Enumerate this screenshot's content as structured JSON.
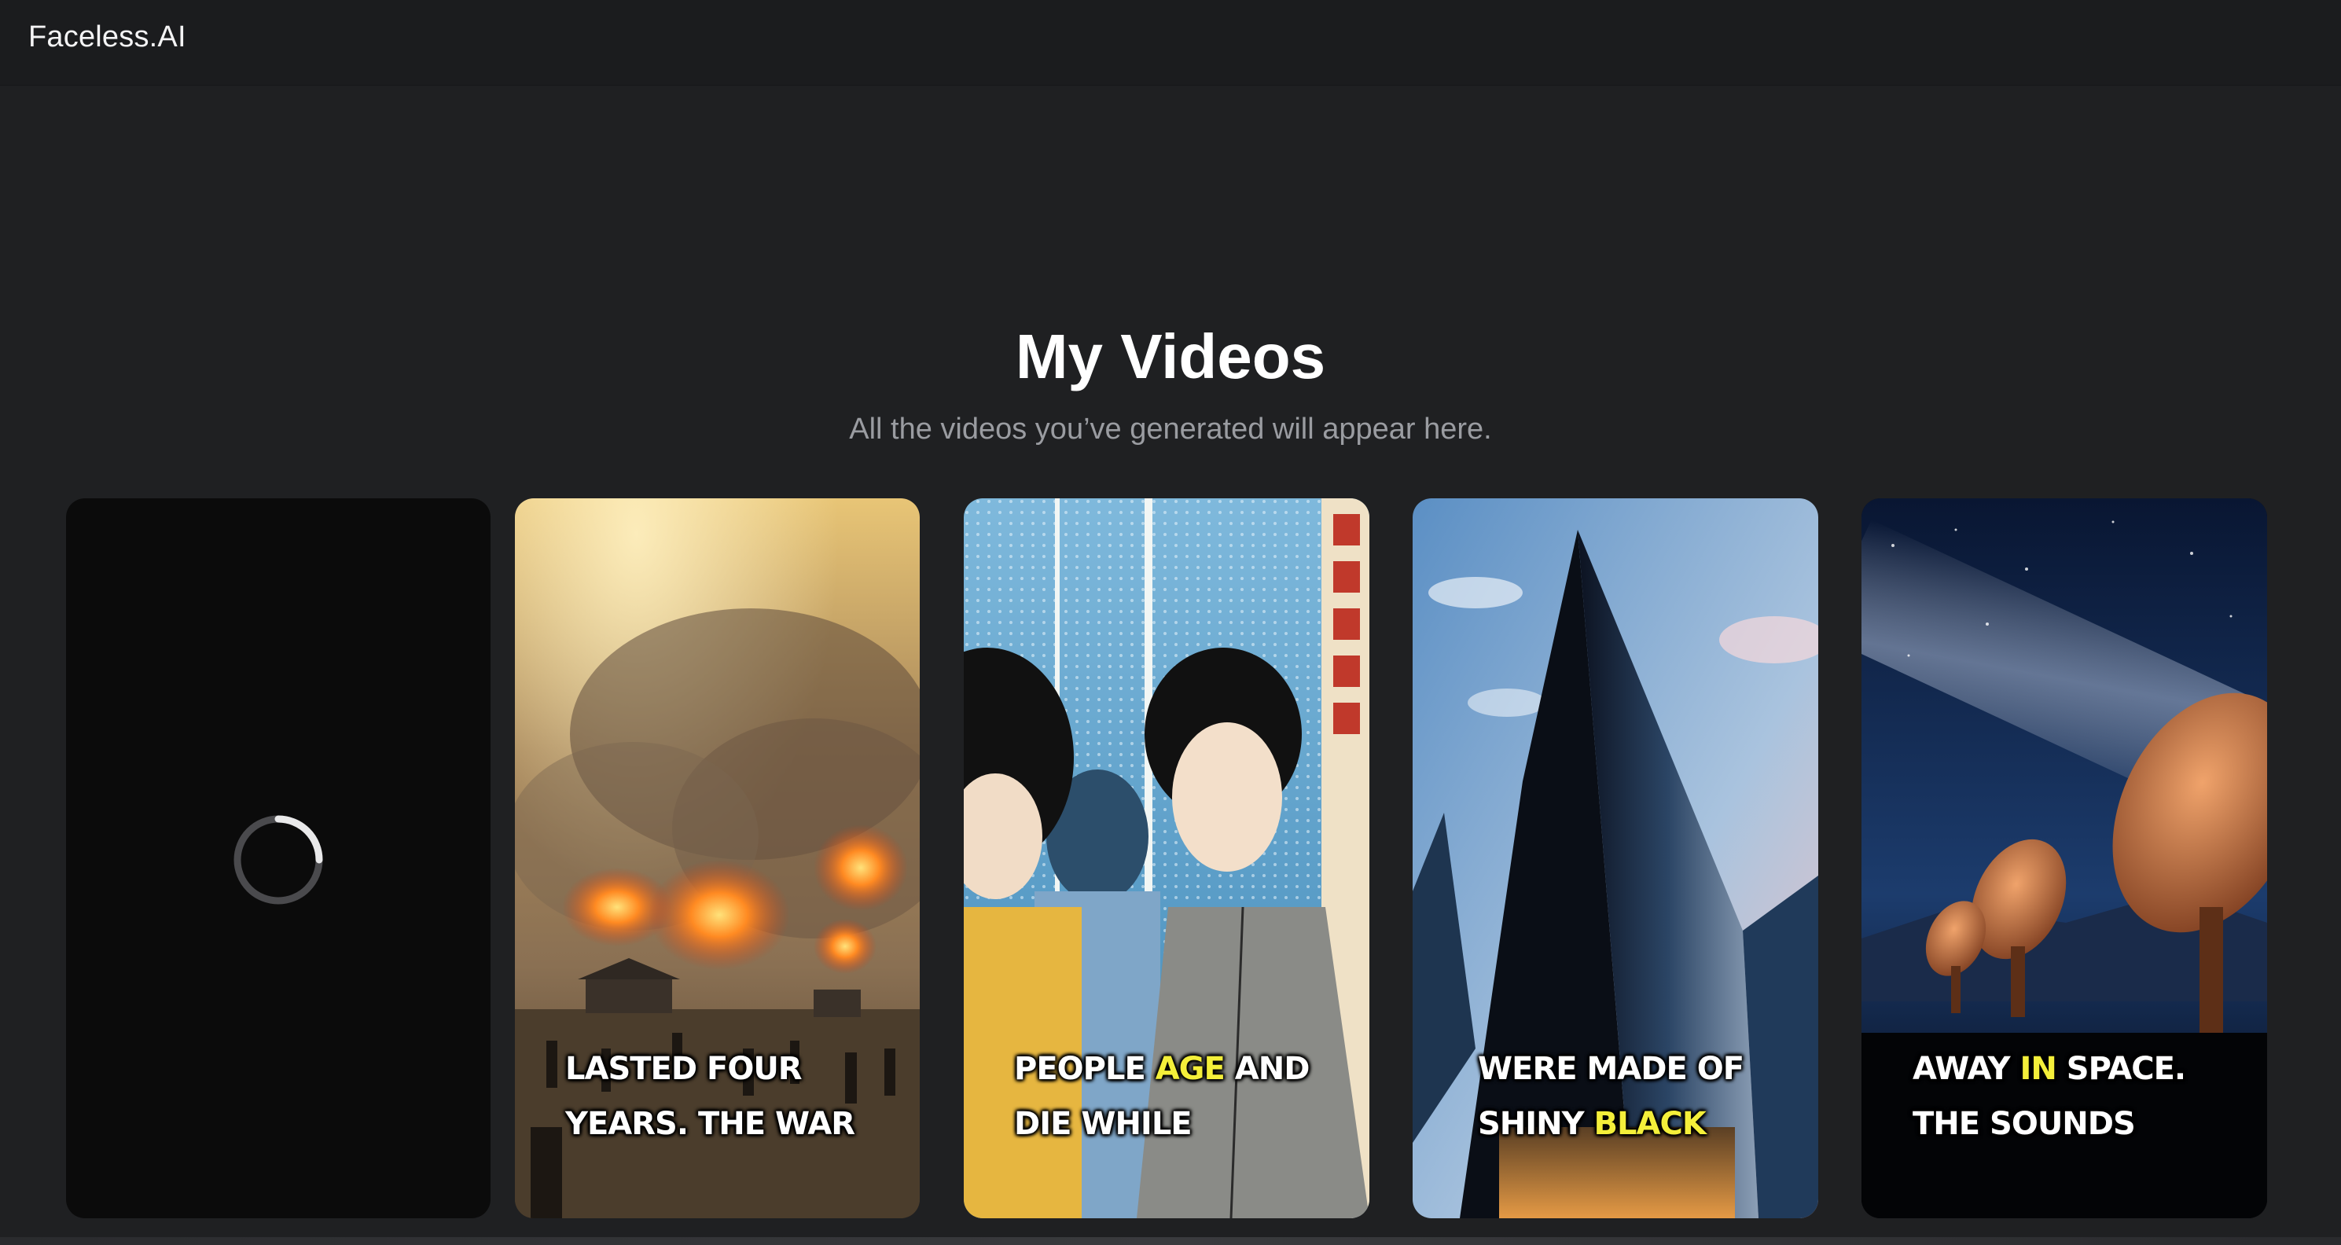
{
  "header": {
    "brand": "Faceless.AI"
  },
  "main": {
    "title": "My Videos",
    "subtitle": "All the videos you’ve generated will appear here."
  },
  "videos": [
    {
      "status": "generating",
      "icon": "loading-spinner-icon"
    },
    {
      "status": "ready",
      "scene": "burning village, war",
      "caption": {
        "line1_a": "LASTED FOUR",
        "line1_hl": "",
        "line1_b": "",
        "line2_a": "YEARS. THE WAR",
        "line2_hl": "",
        "line2_b": ""
      }
    },
    {
      "status": "ready",
      "scene": "manga style people",
      "caption": {
        "line1_a": "PEOPLE ",
        "line1_hl": "AGE",
        "line1_b": " AND",
        "line2_a": "DIE WHILE",
        "line2_hl": "",
        "line2_b": ""
      }
    },
    {
      "status": "ready",
      "scene": "black glass pyramid buildings",
      "caption": {
        "line1_a": "WERE MADE OF",
        "line1_hl": "",
        "line1_b": "",
        "line2_a": "SHINY ",
        "line2_hl": "BLACK",
        "line2_b": ""
      }
    },
    {
      "status": "ready",
      "scene": "radio telescopes under milky way",
      "caption": {
        "line1_a": "AWAY ",
        "line1_hl": "IN",
        "line1_b": " SPACE.",
        "line2_a": "THE SOUNDS",
        "line2_hl": "",
        "line2_b": ""
      }
    }
  ],
  "colors": {
    "background": "#1f2022",
    "header": "#1b1c1e",
    "caption_highlight": "#f4ef3a"
  }
}
